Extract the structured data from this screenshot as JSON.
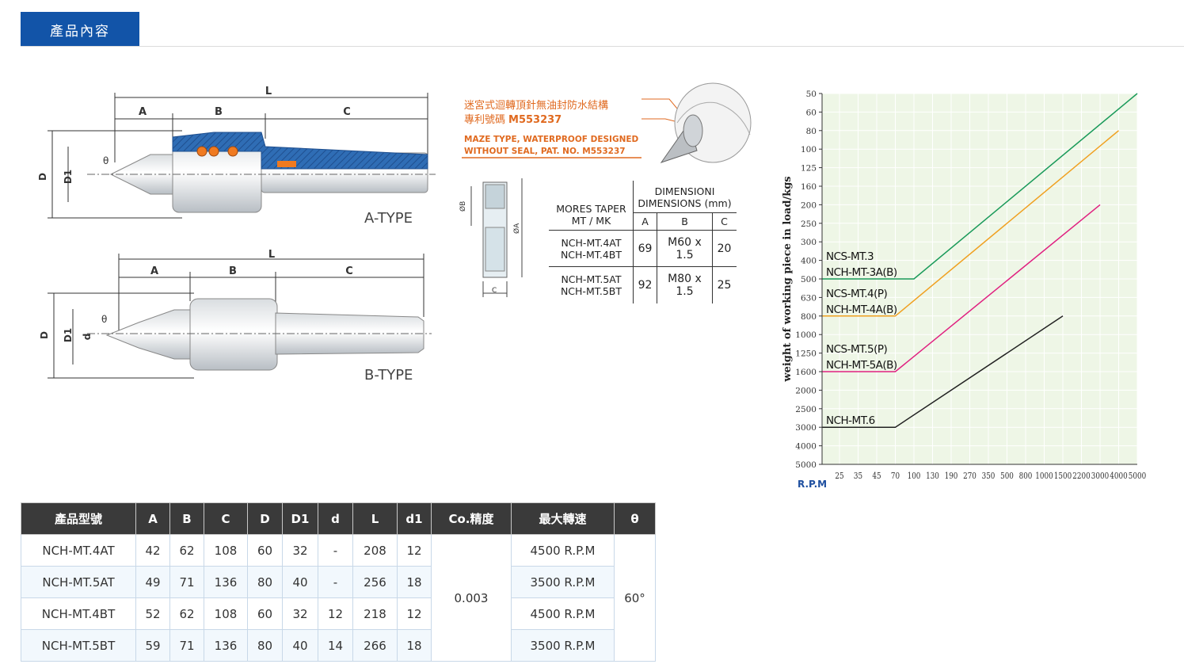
{
  "tabs": {
    "active": "產品內容"
  },
  "drawing": {
    "labels": {
      "L": "L",
      "A": "A",
      "B": "B",
      "C": "C",
      "D": "D",
      "D1": "D1",
      "d": "d",
      "theta": "θ"
    },
    "type_a": "A",
    "type_b": "B",
    "type_suffix": "-TYPE"
  },
  "maze": {
    "zh_line1": "迷宮式迴轉頂針無油封防水結構",
    "zh_line2_prefix": "專利號碼",
    "patent": "M553237",
    "en_line1": "MAZE TYPE, WATERPROOF DESIGNED",
    "en_line2": "WITHOUT SEAL, PAT. NO. M553237"
  },
  "ring": {
    "label_b": "ØB",
    "label_a": "ØA",
    "label_c": "C"
  },
  "dim_table": {
    "col1_line1": "MORES TAPER",
    "col1_line2": "MT / MK",
    "head_line1": "DIMENSIONI",
    "head_line2": "DIMENSIONS (mm)",
    "sub": [
      "A",
      "B",
      "C"
    ],
    "rows": [
      {
        "m1": "NCH-MT.4AT",
        "m2": "NCH-MT.4BT",
        "a": "69",
        "b": "M60 x 1.5",
        "c": "20"
      },
      {
        "m1": "NCH-MT.5AT",
        "m2": "NCH-MT.5BT",
        "a": "92",
        "b": "M80 x 1.5",
        "c": "25"
      }
    ]
  },
  "chart_data": {
    "type": "line",
    "ylabel": "weight of working piece in load/kgs",
    "xlabel": "R.P.M",
    "y_ticks": [
      "50",
      "60",
      "80",
      "100",
      "125",
      "160",
      "200",
      "250",
      "300",
      "400",
      "500",
      "630",
      "800",
      "1000",
      "1250",
      "1600",
      "2000",
      "2500",
      "3000",
      "4000",
      "5000"
    ],
    "x_ticks": [
      "25",
      "35",
      "45",
      "70",
      "100",
      "130",
      "190",
      "270",
      "350",
      "500",
      "800",
      "1000",
      "1500",
      "2200",
      "3000",
      "4000",
      "5000"
    ],
    "series": [
      {
        "name": "NCS-MT.3",
        "name2": "NCH-MT-3A(B)",
        "color": "#1a9a5a",
        "flat_y": "500",
        "knee_x": "100",
        "end_x": "5000",
        "end_y": "50"
      },
      {
        "name": "NCS-MT.4(P)",
        "name2": "NCH-MT-4A(B)",
        "color": "#f0a020",
        "flat_y": "800",
        "knee_x": "70",
        "end_x": "4000",
        "end_y": "80"
      },
      {
        "name": "NCS-MT.5(P)",
        "name2": "NCH-MT-5A(B)",
        "color": "#e02080",
        "flat_y": "1600",
        "knee_x": "70",
        "end_x": "3000",
        "end_y": "200"
      },
      {
        "name": "NCH-MT.6",
        "name2": "",
        "color": "#222222",
        "flat_y": "3000",
        "knee_x": "70",
        "end_x": "1500",
        "end_y": "800"
      }
    ]
  },
  "spec_table": {
    "headers": [
      "產品型號",
      "A",
      "B",
      "C",
      "D",
      "D1",
      "d",
      "L",
      "d1",
      "Co.精度",
      "最大轉速",
      "θ"
    ],
    "rows": [
      {
        "model": "NCH-MT.4AT",
        "a": "42",
        "b": "62",
        "c": "108",
        "d": "60",
        "d1": "32",
        "sd": "-",
        "l": "208",
        "dd1": "12",
        "rpm": "4500 R.P.M"
      },
      {
        "model": "NCH-MT.5AT",
        "a": "49",
        "b": "71",
        "c": "136",
        "d": "80",
        "d1": "40",
        "sd": "-",
        "l": "256",
        "dd1": "18",
        "rpm": "3500 R.P.M"
      },
      {
        "model": "NCH-MT.4BT",
        "a": "52",
        "b": "62",
        "c": "108",
        "d": "60",
        "d1": "32",
        "sd": "12",
        "l": "218",
        "dd1": "12",
        "rpm": "4500 R.P.M"
      },
      {
        "model": "NCH-MT.5BT",
        "a": "59",
        "b": "71",
        "c": "136",
        "d": "80",
        "d1": "40",
        "sd": "14",
        "l": "266",
        "dd1": "18",
        "rpm": "3500 R.P.M"
      }
    ],
    "precision": "0.003",
    "angle": "60°"
  }
}
